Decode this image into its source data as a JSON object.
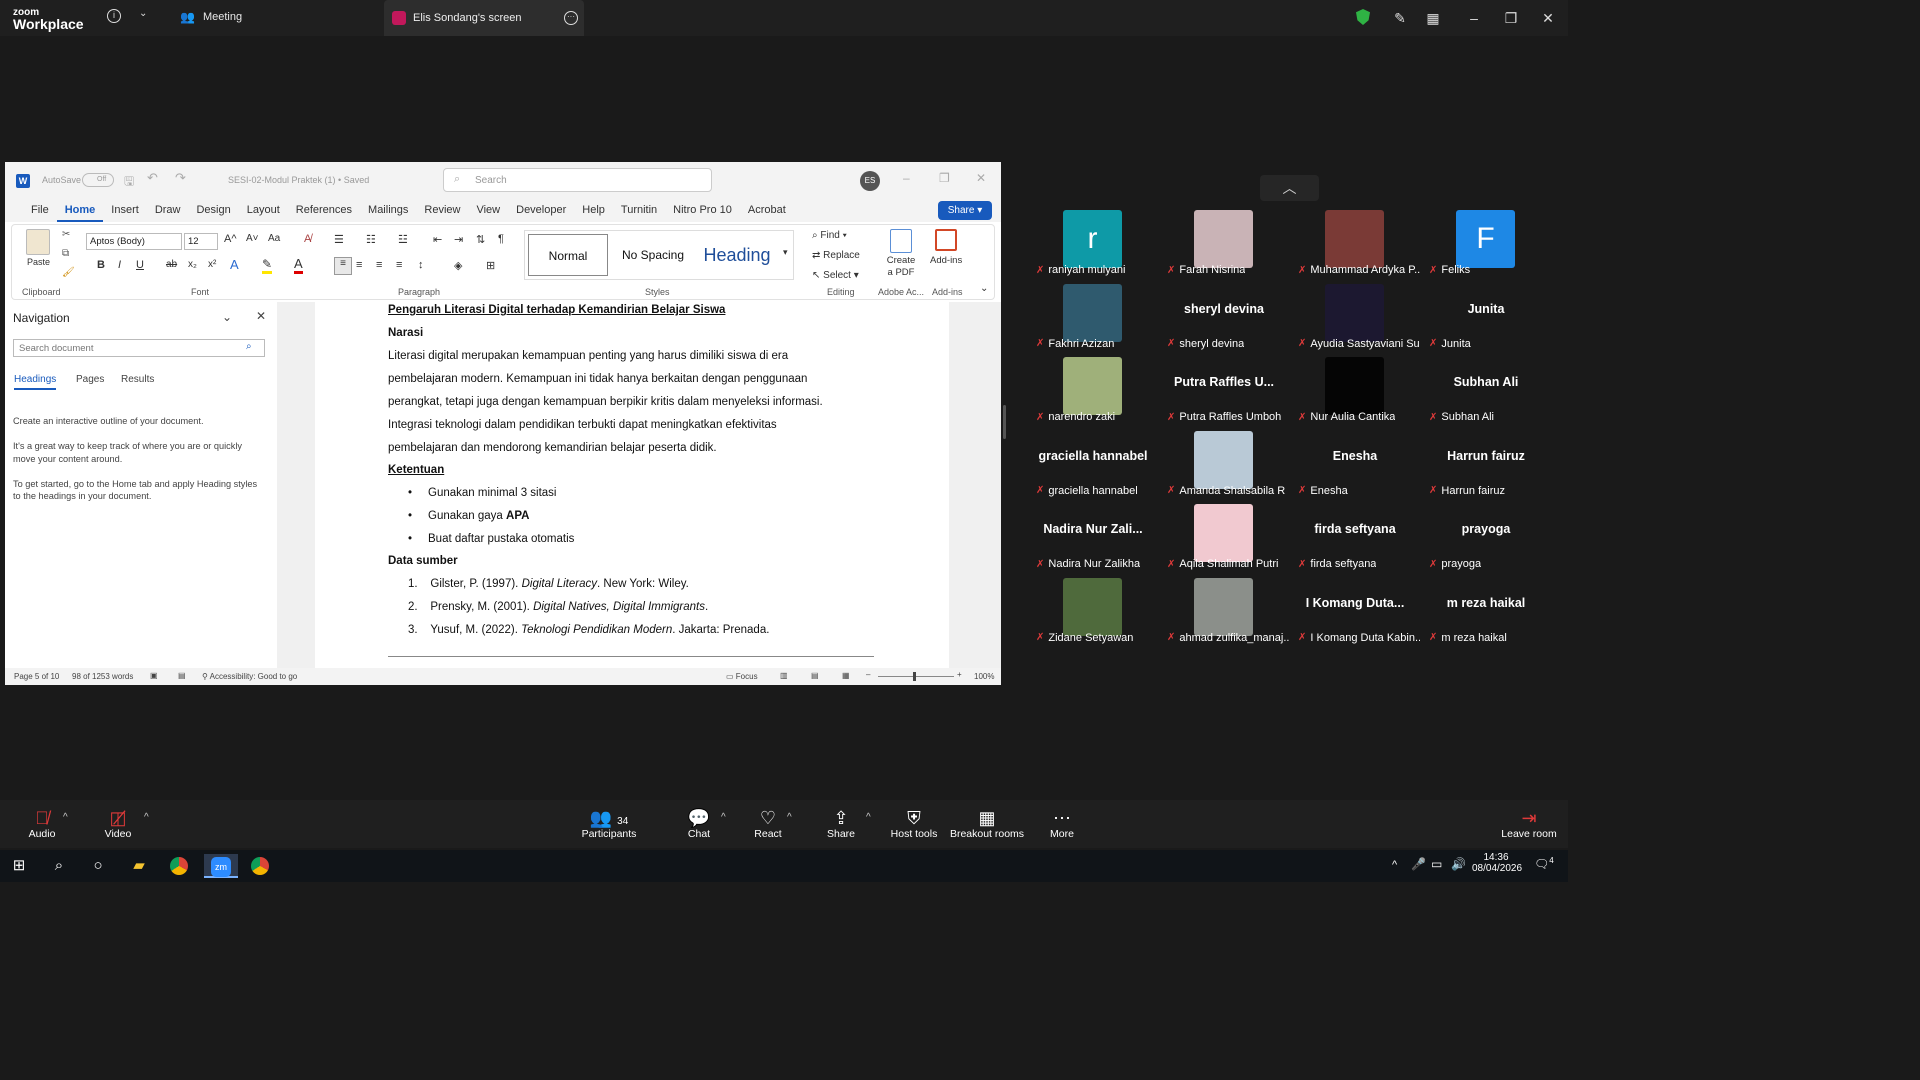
{
  "zoom": {
    "logo_top": "zoom",
    "logo_bottom": "Workplace",
    "meeting_label": "Meeting",
    "screen_tab_label": "Elis Sondang's screen"
  },
  "word": {
    "autosave_label": "AutoSave",
    "autosave_state": "Off",
    "doc_title": "SESI-02-Modul Praktek (1) • Saved",
    "search_placeholder": "Search",
    "avatar_initials": "ES",
    "share_label": "Share",
    "tabs": [
      "File",
      "Home",
      "Insert",
      "Draw",
      "Design",
      "Layout",
      "References",
      "Mailings",
      "Review",
      "View",
      "Developer",
      "Help",
      "Turnitin",
      "Nitro Pro 10",
      "Acrobat"
    ],
    "ribbon": {
      "paste": "Paste",
      "clipboard": "Clipboard",
      "font_name": "Aptos (Body)",
      "font_size": "12",
      "font": "Font",
      "paragraph": "Paragraph",
      "styles": "Styles",
      "style_normal": "Normal",
      "style_nospacing": "No Spacing",
      "style_heading": "Heading",
      "find": "Find",
      "replace": "Replace",
      "select": "Select",
      "editing": "Editing",
      "create_pdf_1": "Create",
      "create_pdf_2": "a PDF",
      "adobe": "Adobe Ac...",
      "addins": "Add-ins",
      "addins_group": "Add-ins"
    },
    "nav": {
      "title": "Navigation",
      "search_placeholder": "Search document",
      "tabs": [
        "Headings",
        "Pages",
        "Results"
      ],
      "p1": "Create an interactive outline of your document.",
      "p2a": "It's a great way to keep track of where you are or quickly",
      "p2b": "move your content around.",
      "p3a": "To get started, go to the Home tab and apply Heading styles",
      "p3b": "to the headings in your document."
    },
    "doc": {
      "title": "Pengaruh Literasi Digital terhadap Kemandirian Belajar Siswa",
      "h_narasi": "Narasi",
      "n1": "Literasi digital merupakan kemampuan penting yang harus dimiliki siswa di era",
      "n2": "pembelajaran modern. Kemampuan ini tidak hanya berkaitan dengan penggunaan",
      "n3": "perangkat, tetapi juga dengan kemampuan berpikir kritis dalam menyeleksi informasi.",
      "n4": "Integrasi teknologi dalam pendidikan terbukti dapat meningkatkan efektivitas",
      "n5": "pembelajaran dan mendorong kemandirian belajar peserta didik.",
      "h_ketentuan": "Ketentuan",
      "b1": "Gunakan minimal 3 sitasi",
      "b2a": "Gunakan gaya ",
      "b2b": "APA",
      "b3": "Buat daftar pustaka otomatis",
      "h_data": "Data sumber",
      "r1a": "Gilster, P. (1997). ",
      "r1b": "Digital Literacy",
      "r1c": ". New York: Wiley.",
      "r2a": "Prensky, M. (2001). ",
      "r2b": "Digital Natives, Digital Immigrants",
      "r2c": ".",
      "r3a": "Yusuf, M. (2022). ",
      "r3b": "Teknologi Pendidikan Modern",
      "r3c": ". Jakarta: Prenada."
    },
    "status": {
      "page": "Page 5 of 10",
      "words": "98 of 1253 words",
      "accessibility": "Accessibility: Good to go",
      "focus": "Focus",
      "zoom": "100%"
    }
  },
  "participants": [
    {
      "big": "",
      "name": "raniyah mulyani",
      "initial": "r",
      "color": "#0e9aa7"
    },
    {
      "big": "",
      "name": "Farah Nisrina",
      "initial": "",
      "color": "#c9b3b6"
    },
    {
      "big": "",
      "name": "Muhammad Ardyka P...",
      "initial": "",
      "color": "#7a3a36"
    },
    {
      "big": "",
      "name": "Feliks",
      "initial": "F",
      "color": "#1e88e5"
    },
    {
      "big": "",
      "name": "Fakhri Azizan",
      "initial": "",
      "color": "#2f5a6e"
    },
    {
      "big": "sheryl devina",
      "name": "sheryl devina",
      "initial": "",
      "color": ""
    },
    {
      "big": "",
      "name": "Ayudia Sastyaviani Su...",
      "initial": "",
      "color": "#1c1830"
    },
    {
      "big": "Junita",
      "name": "Junita",
      "initial": "",
      "color": ""
    },
    {
      "big": "",
      "name": "narendro zaki",
      "initial": "",
      "color": "#9fb07a"
    },
    {
      "big": "Putra Raffles U...",
      "name": "Putra Raffles Umboh",
      "initial": "",
      "color": ""
    },
    {
      "big": "",
      "name": "Nur Aulia Cantika",
      "initial": "",
      "color": "#050505"
    },
    {
      "big": "Subhan Ali",
      "name": "Subhan Ali",
      "initial": "",
      "color": ""
    },
    {
      "big": "graciella hannabel",
      "name": "graciella hannabel",
      "initial": "",
      "color": ""
    },
    {
      "big": "",
      "name": "Amanda Shalsabila R",
      "initial": "",
      "color": "#b9c9d6"
    },
    {
      "big": "Enesha",
      "name": "Enesha",
      "initial": "",
      "color": ""
    },
    {
      "big": "Harrun fairuz",
      "name": "Harrun fairuz",
      "initial": "",
      "color": ""
    },
    {
      "big": "Nadira Nur Zali...",
      "name": "Nadira Nur Zalikha",
      "initial": "",
      "color": ""
    },
    {
      "big": "",
      "name": "Aqila Shalimah Putri",
      "initial": "",
      "color": "#f1c9d0"
    },
    {
      "big": "firda seftyana",
      "name": "firda seftyana",
      "initial": "",
      "color": ""
    },
    {
      "big": "prayoga",
      "name": "prayoga",
      "initial": "",
      "color": ""
    },
    {
      "big": "",
      "name": "Zidane Setyawan",
      "initial": "",
      "color": "#4f6a3c"
    },
    {
      "big": "",
      "name": "ahmad zulfika_manaj...",
      "initial": "",
      "color": "#8b8f8a"
    },
    {
      "big": "I Komang Duta...",
      "name": "I Komang Duta Kabin...",
      "initial": "",
      "color": ""
    },
    {
      "big": "m reza haikal",
      "name": "m reza haikal",
      "initial": "",
      "color": ""
    }
  ],
  "toolbar": {
    "audio": "Audio",
    "video": "Video",
    "participants": "Participants",
    "participants_count": "34",
    "chat": "Chat",
    "react": "React",
    "share": "Share",
    "host_tools": "Host tools",
    "breakout": "Breakout rooms",
    "more": "More",
    "leave": "Leave room"
  },
  "taskbar": {
    "time": "14:36",
    "date": "08/04/2026",
    "notif_count": "4"
  }
}
